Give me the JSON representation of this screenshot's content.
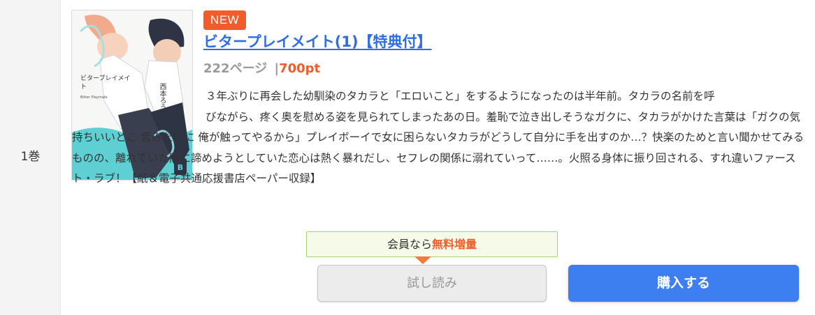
{
  "volume": {
    "label": "1巻"
  },
  "book": {
    "badge": "NEW",
    "title": "ビタープレイメイト(1)【特典付】",
    "pages": "222ページ",
    "separator": "|",
    "price": "700pt",
    "cover": {
      "title": "ビタープレイメイト",
      "subtitle": "Bitter Playmate",
      "author": "西本ろう"
    },
    "description_line1": "３年ぶりに再会した幼馴染のタカラと「エロいこと」をするようになったのは半年前。タカラの名前を呼",
    "description_rest": "びながら、疼く奥を慰める姿を見られてしまったあの日。羞恥で泣き出しそうなガクに、タカラがかけた言葉は「ガクの気持ちいいとこ 昔みたいに 俺が触ってやるから」プレイボーイで女に困らないタカラがどうして自分に手を出すのか…？快楽のためと言い聞かせてみるものの、離れていた間に諦めようとしていた恋心は熱く暴れだし、セフレの関係に溺れていって……。火照る身体に振り回される、すれ違いファースト・ラブ！【紙＆電子共通応援書店ペーパー収録】"
  },
  "member": {
    "prefix": "会員なら",
    "highlight": "無料増量"
  },
  "actions": {
    "trial_label": "試し読み",
    "buy_label": "購入する"
  },
  "colors": {
    "accent_orange": "#f25c2a",
    "link_blue": "#2d6ee6",
    "buy_blue": "#3d7ef0",
    "cover_teal": "#5ecfd2"
  }
}
